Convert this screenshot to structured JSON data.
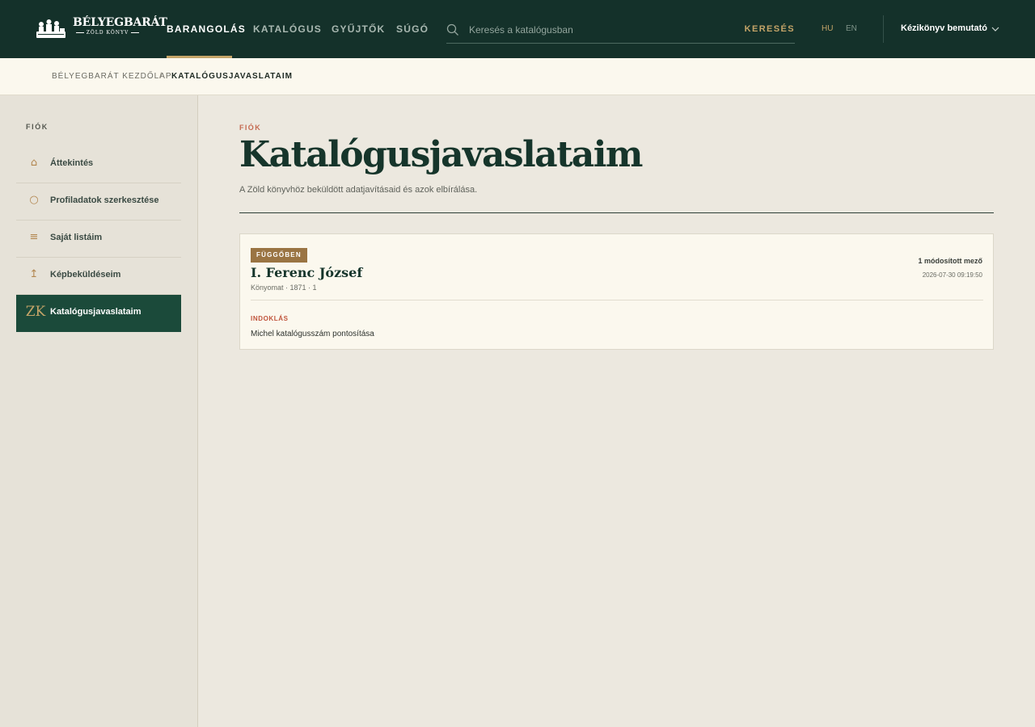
{
  "header": {
    "logo_title": "BÉLYEGBARÁT",
    "logo_subtitle": "ZÖLD KÖNYV",
    "nav": [
      {
        "label": "BARANGOLÁS",
        "active": true
      },
      {
        "label": "KATALÓGUS",
        "active": false
      },
      {
        "label": "GYŰJTŐK",
        "active": false
      },
      {
        "label": "SÚGÓ",
        "active": false
      }
    ],
    "search": {
      "placeholder": "Keresés a katalógusban",
      "value": "",
      "button_label": "KERESÉS"
    },
    "languages": {
      "hu": "HU",
      "en": "EN",
      "active": "HU"
    },
    "guide_label": "Kézikönyv bemutató",
    "colors": {
      "header_bg": "#14312a",
      "accent": "#c4a468"
    }
  },
  "breadcrumb": {
    "home": "BÉLYEGBARÁT KEZDŐLAP",
    "separator": "/",
    "current": "KATALÓGUSJAVASLATAIM"
  },
  "sidebar": {
    "heading": "FIÓK",
    "items": [
      {
        "label": "Áttekintés",
        "icon": "house-icon",
        "glyph": "⌂",
        "active": false
      },
      {
        "label": "Profiladatok szerkesztése",
        "icon": "circle-icon",
        "glyph": "○",
        "active": false
      },
      {
        "label": "Saját listáim",
        "icon": "list-icon",
        "glyph": "≡",
        "active": false
      },
      {
        "label": "Képbeküldéseim",
        "icon": "upload-icon",
        "glyph": "↥",
        "active": false
      },
      {
        "label": "Katalógusjavaslataim",
        "icon": "zk-monogram-icon",
        "glyph": "ZK",
        "active": true
      }
    ]
  },
  "main": {
    "kicker": "FIÓK",
    "title": "Katalógusjavaslataim",
    "description": "A Zöld könyvhöz beküldött adatjavításaid és azok elbírálása.",
    "suggestions": [
      {
        "status": "FÜGGŐBEN",
        "title": "I. Ferenc József",
        "meta": "Könyomat · 1871 · 1",
        "changed_fields": "1 módosított mező",
        "timestamp": "2026-07-30 09:19:50",
        "reason_label": "INDOKLÁS",
        "reason": "Michel katalógusszám pontosítása"
      }
    ]
  }
}
